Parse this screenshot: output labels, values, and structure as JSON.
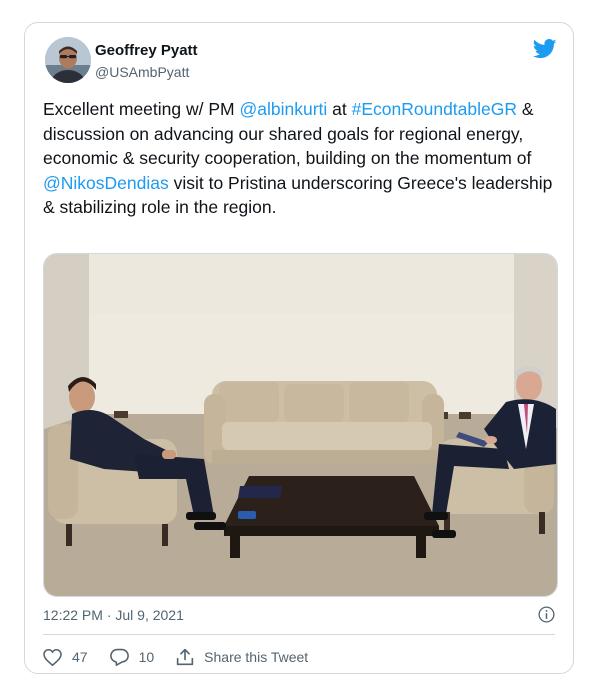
{
  "author": {
    "name": "Geoffrey Pyatt",
    "handle": "@USAmbPyatt"
  },
  "tweet": {
    "t1": "Excellent meeting w/ PM ",
    "mention1": "@albinkurti",
    "t2": " at ",
    "hashtag": "#EconRoundtableGR",
    "t3": " & discussion on advancing our shared goals for regional energy, economic & security cooperation, building on the momentum of ",
    "mention2": "@NikosDendias",
    "t4": " visit to Pristina underscoring Greece's leadership & stabilizing role in the region."
  },
  "timestamp": "12:22 PM · Jul 9, 2021",
  "actions": {
    "likes": "47",
    "replies": "10",
    "share_label": "Share this Tweet"
  },
  "colors": {
    "accent": "#1d9bf0",
    "text": "#0f1419",
    "secondary": "#536471",
    "border": "#cfd9de"
  },
  "icons": [
    "twitter-bird-icon",
    "info-icon",
    "heart-icon",
    "reply-icon",
    "share-icon"
  ]
}
